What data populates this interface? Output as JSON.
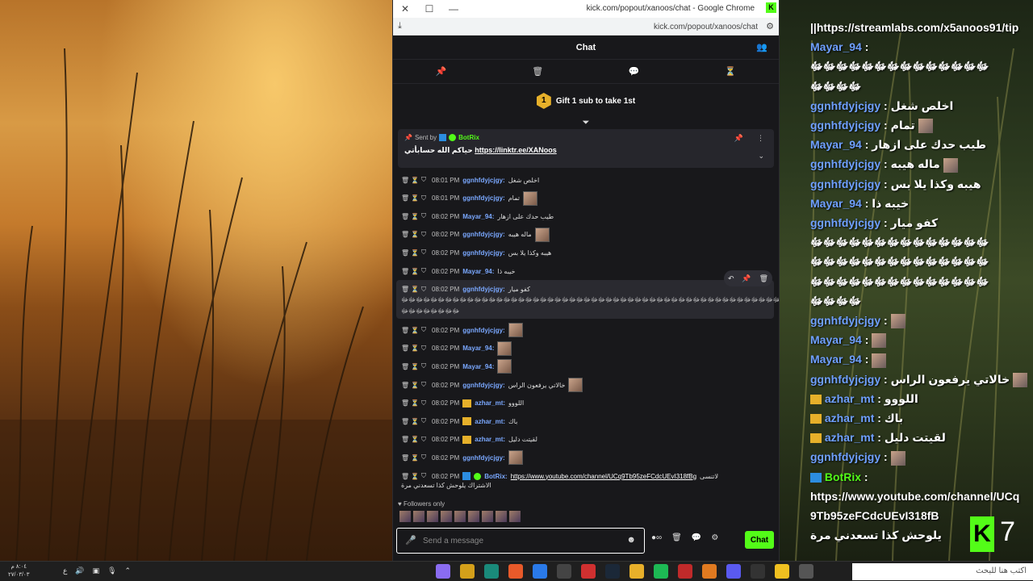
{
  "window": {
    "title": "kick.com/popout/xanoos/chat - Google Chrome",
    "url": "kick.com/popout/xanoos/chat"
  },
  "chat": {
    "header": "Chat",
    "gift_text": "Gift 1 sub to take 1st",
    "gift_count": "1",
    "pinned": {
      "sent_by_label": "Sent by",
      "sender": "BotRix",
      "text": "حياكم الله حسابأتي",
      "link": "https://linktr.ee/XANoos"
    },
    "messages": [
      {
        "time": "08:01 PM",
        "user": "ggnhfdyjcjgy",
        "text": "اخلص شغل",
        "avatar": false,
        "badge": ""
      },
      {
        "time": "08:01 PM",
        "user": "ggnhfdyjcjgy",
        "text": "تمام",
        "avatar": true,
        "badge": ""
      },
      {
        "time": "08:02 PM",
        "user": "Mayar_94",
        "text": "طيب حدك على ازهار",
        "avatar": false,
        "badge": ""
      },
      {
        "time": "08:02 PM",
        "user": "ggnhfdyjcjgy",
        "text": "ماله هيبه",
        "avatar": true,
        "badge": ""
      },
      {
        "time": "08:02 PM",
        "user": "ggnhfdyjcjgy",
        "text": "هيبه وكذا يلا بس",
        "avatar": false,
        "badge": ""
      },
      {
        "time": "08:02 PM",
        "user": "Mayar_94",
        "text": "خيبه ذا",
        "avatar": false,
        "badge": ""
      },
      {
        "time": "08:02 PM",
        "user": "ggnhfdyjcjgy",
        "text": "كفو ميار",
        "avatar": false,
        "badge": "",
        "hover": true,
        "line2": "ﷻﷻﷻﷻﷻﷻﷻﷻﷻﷻﷻﷻﷻﷻﷻﷻﷻﷻﷻﷻﷻﷻﷻﷻﷻﷻﷻﷻﷻﷻﷻﷻﷻﷻﷻﷻﷻﷻﷻﷻﷻﷻﷻﷻﷻﷻﷻﷻﷻﷻﷻﷻﷻﷻﷻﷻ",
        "line3": "ﷻﷻﷻﷻﷻﷻﷻﷻ"
      },
      {
        "time": "08:02 PM",
        "user": "ggnhfdyjcjgy",
        "text": "",
        "avatar": true,
        "badge": ""
      },
      {
        "time": "08:02 PM",
        "user": "Mayar_94",
        "text": "",
        "avatar": true,
        "badge": ""
      },
      {
        "time": "08:02 PM",
        "user": "Mayar_94",
        "text": "",
        "avatar": true,
        "badge": ""
      },
      {
        "time": "08:02 PM",
        "user": "ggnhfdyjcjgy",
        "text": "خالاتي يرفعون الراس",
        "avatar": true,
        "badge": ""
      },
      {
        "time": "08:02 PM",
        "user": "azhar_mt",
        "text": "اللووو",
        "avatar": false,
        "badge": "crown"
      },
      {
        "time": "08:02 PM",
        "user": "azhar_mt",
        "text": "باك",
        "avatar": false,
        "badge": "crown"
      },
      {
        "time": "08:02 PM",
        "user": "azhar_mt",
        "text": "لقيتت دليل",
        "avatar": false,
        "badge": "crown"
      },
      {
        "time": "08:02 PM",
        "user": "ggnhfdyjcjgy",
        "text": "",
        "avatar": true,
        "badge": ""
      },
      {
        "time": "08:02 PM",
        "user": "BotRix",
        "text": "لاتنسى",
        "avatar": false,
        "badge": "bot",
        "link": "https://www.youtube.com/channel/UCq9Tb95zeFCdcUEvI318fBg",
        "line2": "الاشتراك يلوحش كذا تسعدني مرة"
      }
    ],
    "followers_only": "Followers only",
    "composer_placeholder": "Send a message",
    "send_label": "Chat"
  },
  "overlay": {
    "lines": [
      {
        "user": "",
        "text": "||https://streamlabs.com/x5anoos91/tip",
        "kind": "text"
      },
      {
        "user": "Mayar_94",
        "text": "",
        "kind": "user"
      },
      {
        "user": "",
        "text": "ﷻﷻﷻﷻﷻﷻﷻﷻﷻﷻﷻﷻﷻﷻ",
        "kind": "text"
      },
      {
        "user": "",
        "text": "ﷻﷻﷻﷻ",
        "kind": "text"
      },
      {
        "user": "ggnhfdyjcjgy",
        "text": "اخلص شغل",
        "kind": "user"
      },
      {
        "user": "ggnhfdyjcjgy",
        "text": "تمام",
        "kind": "user",
        "avatar": true
      },
      {
        "user": "Mayar_94",
        "text": "طيب حدك على ازهار",
        "kind": "user"
      },
      {
        "user": "ggnhfdyjcjgy",
        "text": "ماله هيبه",
        "kind": "user",
        "avatar": true
      },
      {
        "user": "ggnhfdyjcjgy",
        "text": "هيبه وكذا يلا بس",
        "kind": "user"
      },
      {
        "user": "Mayar_94",
        "text": "خيبه ذا",
        "kind": "user"
      },
      {
        "user": "ggnhfdyjcjgy",
        "text": "كفو ميار",
        "kind": "user"
      },
      {
        "user": "",
        "text": "ﷻﷻﷻﷻﷻﷻﷻﷻﷻﷻﷻﷻﷻﷻ",
        "kind": "text"
      },
      {
        "user": "",
        "text": "ﷻﷻﷻﷻﷻﷻﷻﷻﷻﷻﷻﷻﷻﷻ",
        "kind": "text"
      },
      {
        "user": "",
        "text": "ﷻﷻﷻﷻﷻﷻﷻﷻﷻﷻﷻﷻﷻﷻ",
        "kind": "text"
      },
      {
        "user": "",
        "text": "ﷻﷻﷻﷻ",
        "kind": "text"
      },
      {
        "user": "ggnhfdyjcjgy",
        "text": "",
        "kind": "user",
        "avatar": true
      },
      {
        "user": "Mayar_94",
        "text": "",
        "kind": "user",
        "avatar": true
      },
      {
        "user": "Mayar_94",
        "text": "",
        "kind": "user",
        "avatar": true
      },
      {
        "user": "ggnhfdyjcjgy",
        "text": "خالاتي يرفعون الراس",
        "kind": "user",
        "avatar": true
      },
      {
        "user": "azhar_mt",
        "text": "اللووو",
        "kind": "user",
        "crown": true
      },
      {
        "user": "azhar_mt",
        "text": "باك",
        "kind": "user",
        "crown": true
      },
      {
        "user": "azhar_mt",
        "text": "لقيتت دليل",
        "kind": "user",
        "crown": true
      },
      {
        "user": "ggnhfdyjcjgy",
        "text": "",
        "kind": "user",
        "avatar": true
      },
      {
        "user": "BotRix",
        "text": "",
        "kind": "user",
        "bot": true
      },
      {
        "user": "",
        "text": "https://www.youtube.com/channel/UCq",
        "kind": "text"
      },
      {
        "user": "",
        "text": "9Tb95zeFCdcUEvI318fB",
        "kind": "text"
      },
      {
        "user": "",
        "text": "يلوحش كذا تسعدني مرة",
        "kind": "text"
      }
    ],
    "kick_letter": "K",
    "number": "7"
  },
  "taskbar": {
    "time": "٨:٠٤ م",
    "date": "٢٧/٠٣/٠٣",
    "lang": "ع",
    "search_placeholder": "اكتب هنا للبحث"
  },
  "colors": {
    "accent": "#53fc18",
    "username": "#7aa8ff",
    "panel": "#18181b"
  }
}
